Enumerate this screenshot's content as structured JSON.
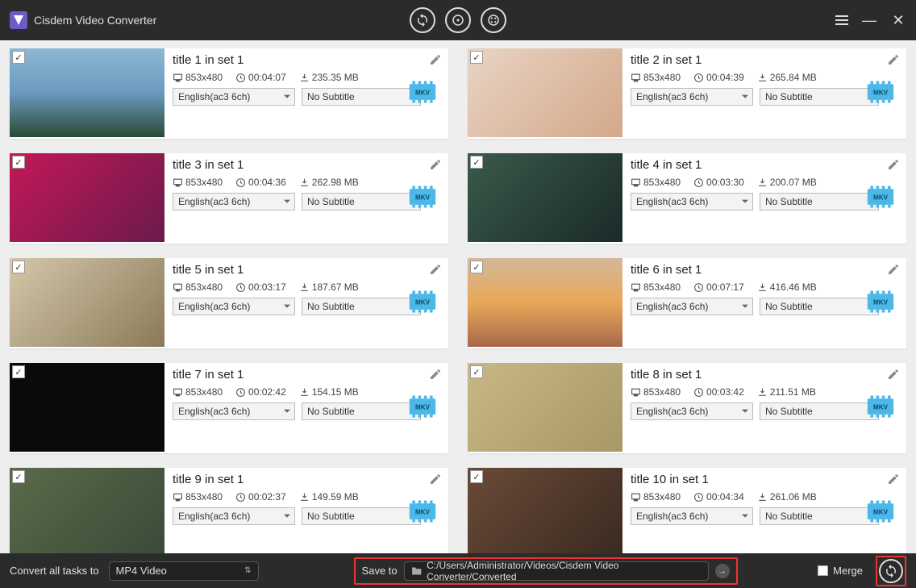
{
  "app": {
    "title": "Cisdem Video Converter"
  },
  "items": [
    {
      "title": "title 1 in set 1",
      "res": "853x480",
      "dur": "00:04:07",
      "size": "235.35 MB",
      "audio": "English(ac3 6ch)",
      "sub": "No Subtitle",
      "fmt": "MKV"
    },
    {
      "title": "title 2 in set 1",
      "res": "853x480",
      "dur": "00:04:39",
      "size": "265.84 MB",
      "audio": "English(ac3 6ch)",
      "sub": "No Subtitle",
      "fmt": "MKV"
    },
    {
      "title": "title 3 in set 1",
      "res": "853x480",
      "dur": "00:04:36",
      "size": "262.98 MB",
      "audio": "English(ac3 6ch)",
      "sub": "No Subtitle",
      "fmt": "MKV"
    },
    {
      "title": "title 4 in set 1",
      "res": "853x480",
      "dur": "00:03:30",
      "size": "200.07 MB",
      "audio": "English(ac3 6ch)",
      "sub": "No Subtitle",
      "fmt": "MKV"
    },
    {
      "title": "title 5 in set 1",
      "res": "853x480",
      "dur": "00:03:17",
      "size": "187.67 MB",
      "audio": "English(ac3 6ch)",
      "sub": "No Subtitle",
      "fmt": "MKV"
    },
    {
      "title": "title 6 in set 1",
      "res": "853x480",
      "dur": "00:07:17",
      "size": "416.46 MB",
      "audio": "English(ac3 6ch)",
      "sub": "No Subtitle",
      "fmt": "MKV"
    },
    {
      "title": "title 7 in set 1",
      "res": "853x480",
      "dur": "00:02:42",
      "size": "154.15 MB",
      "audio": "English(ac3 6ch)",
      "sub": "No Subtitle",
      "fmt": "MKV"
    },
    {
      "title": "title 8 in set 1",
      "res": "853x480",
      "dur": "00:03:42",
      "size": "211.51 MB",
      "audio": "English(ac3 6ch)",
      "sub": "No Subtitle",
      "fmt": "MKV"
    },
    {
      "title": "title 9 in set 1",
      "res": "853x480",
      "dur": "00:02:37",
      "size": "149.59 MB",
      "audio": "English(ac3 6ch)",
      "sub": "No Subtitle",
      "fmt": "MKV"
    },
    {
      "title": "title 10 in set 1",
      "res": "853x480",
      "dur": "00:04:34",
      "size": "261.06 MB",
      "audio": "English(ac3 6ch)",
      "sub": "No Subtitle",
      "fmt": "MKV"
    }
  ],
  "bottom": {
    "convert_label": "Convert all tasks to",
    "format": "MP4 Video",
    "saveto_label": "Save to",
    "path": "C:/Users/Administrator/Videos/Cisdem Video Converter/Converted",
    "merge_label": "Merge"
  }
}
